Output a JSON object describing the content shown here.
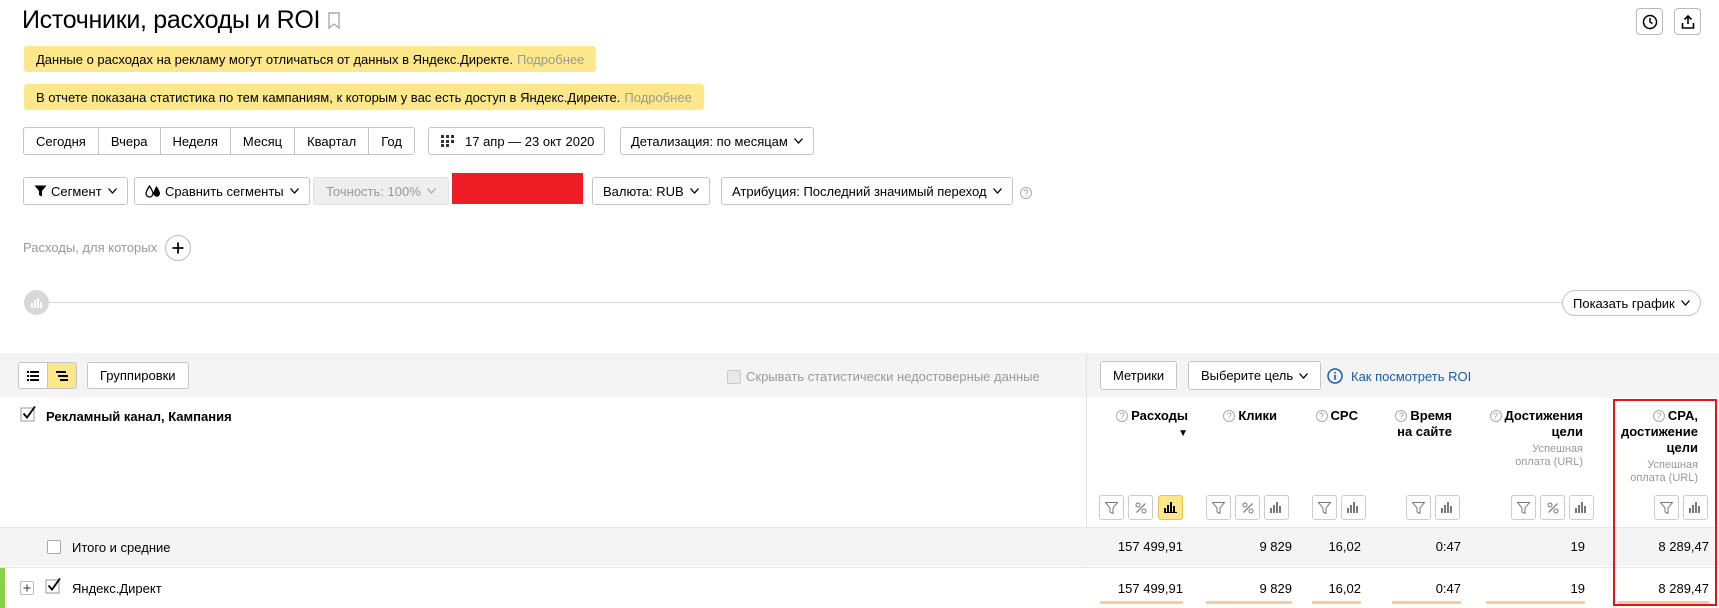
{
  "header": {
    "title": "Источники, расходы и ROI"
  },
  "notices": [
    {
      "text": "Данные о расходах на рекламу могут отличаться от данных в Яндекс.Директе.",
      "link": "Подробнее"
    },
    {
      "text": "В отчете показана статистика по тем кампаниям, к которым у вас есть доступ в Яндекс.Директе.",
      "link": "Подробнее"
    }
  ],
  "periods": [
    "Сегодня",
    "Вчера",
    "Неделя",
    "Месяц",
    "Квартал",
    "Год"
  ],
  "date_range": "17 апр — 23 окт 2020",
  "detail": "Детализация: по месяцам",
  "filters": {
    "segment": "Сегмент",
    "compare": "Сравнить сегменты",
    "accuracy": "Точность: 100%",
    "currency": "Валюта: RUB",
    "attribution": "Атрибуция: Последний значимый переход"
  },
  "redacted_color": "#ee1c25",
  "expenses_label": "Расходы, для которых",
  "show_chart": "Показать график",
  "toolbar": {
    "groupings": "Группировки",
    "hide_unreliable": "Скрывать статистически недостоверные данные",
    "metrics": "Метрики",
    "select_goal": "Выберите цель",
    "how_roi": "Как посмотреть ROI"
  },
  "table": {
    "dimension_header": "Рекламный канал, Кампания",
    "columns": [
      {
        "label": "Расходы",
        "sort": "▼"
      },
      {
        "label": "Клики"
      },
      {
        "label": "CPC"
      },
      {
        "label_lines": [
          "Время",
          "на сайте"
        ]
      },
      {
        "label_lines": [
          "Достижения",
          "цели"
        ],
        "sub_lines": [
          "Успешная",
          "оплата (URL)"
        ]
      },
      {
        "label_lines": [
          "CPA,",
          "достижение",
          "цели"
        ],
        "sub_lines": [
          "Успешная",
          "оплата (URL)"
        ]
      }
    ],
    "rows": [
      {
        "name": "Итого и средние",
        "values": [
          "157 499,91",
          "9 829",
          "16,02",
          "0:47",
          "19",
          "8 289,47"
        ]
      },
      {
        "name": "Яндекс.Директ",
        "values": [
          "157 499,91",
          "9 829",
          "16,02",
          "0:47",
          "19",
          "8 289,47"
        ]
      }
    ]
  },
  "colors": {
    "notice": "#fce88a",
    "highlight_frame": "#e0161c",
    "link": "#1a5aa8",
    "row_accent": "#8ccf4e"
  }
}
